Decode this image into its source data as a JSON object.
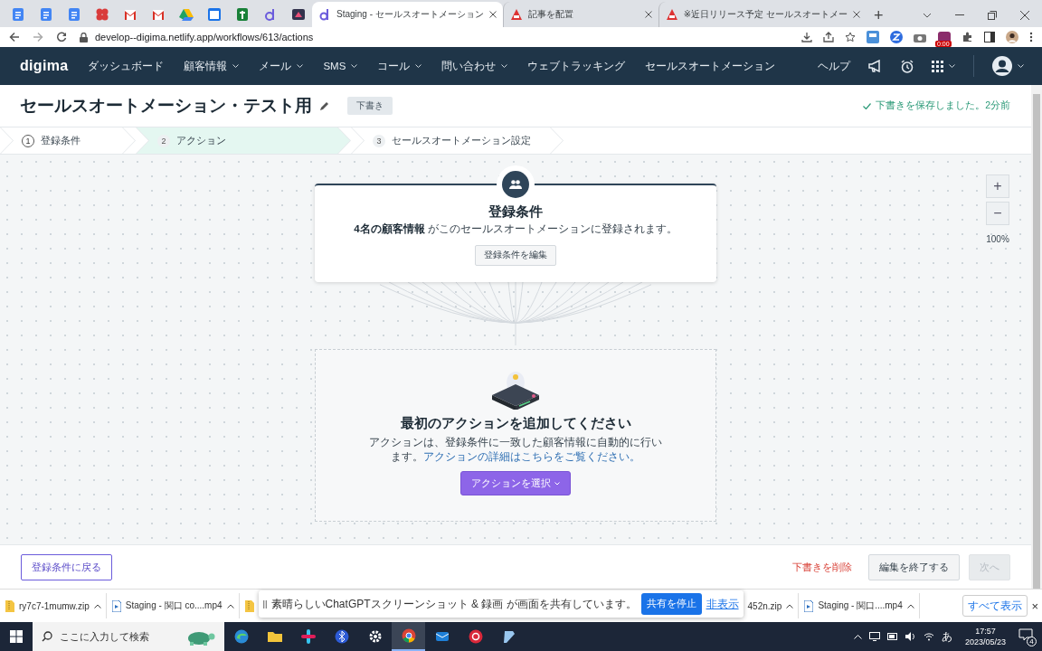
{
  "browser": {
    "tabs": [
      {
        "title": "Staging - セールスオートメーション",
        "selected": true,
        "kind": "digima"
      },
      {
        "title": "記事を配置",
        "selected": false,
        "kind": "cms"
      },
      {
        "title": "※近日リリース予定 セールスオートメー",
        "selected": false,
        "kind": "cms"
      }
    ],
    "new_tab": "+",
    "address": "develop--digima.netlify.app/workflows/613/actions",
    "recording_badge": "0:00"
  },
  "nav": {
    "logo": "digima",
    "items": [
      {
        "label": "ダッシュボード",
        "dropdown": false
      },
      {
        "label": "顧客情報",
        "dropdown": true
      },
      {
        "label": "メール",
        "dropdown": true
      },
      {
        "label": "SMS",
        "dropdown": true
      },
      {
        "label": "コール",
        "dropdown": true
      },
      {
        "label": "問い合わせ",
        "dropdown": true
      },
      {
        "label": "ウェブトラッキング",
        "dropdown": false
      },
      {
        "label": "セールスオートメーション",
        "dropdown": false
      }
    ],
    "help": "ヘルプ"
  },
  "header": {
    "title": "セールスオートメーション・テスト用",
    "status_badge": "下書き",
    "save_status": "下書きを保存しました。2分前"
  },
  "steps": [
    {
      "number": "1",
      "label": "登録条件",
      "selected": false,
      "completed": true
    },
    {
      "number": "2",
      "label": "アクション",
      "selected": true,
      "completed": false
    },
    {
      "number": "3",
      "label": "セールスオートメーション設定",
      "selected": false,
      "completed": false
    }
  ],
  "trigger_card": {
    "title": "登録条件",
    "summary": "**4名の顧客情報** がこのセールスオートメーションに登録されます。",
    "edit_button": "登録条件を編集"
  },
  "action_placeholder": {
    "heading": "最初のアクションを追加してください",
    "description": "アクションは、登録条件に一致した顧客情報に自動的に行います。",
    "link": "アクションの詳細はこちらをご覧ください。",
    "select_button": "アクションを選択"
  },
  "zoom": {
    "zoom_in": "+",
    "zoom_out": "−",
    "level_text": "100%"
  },
  "footer": {
    "back_button": "登録条件に戻る",
    "delete_button": "下書きを削除",
    "finish_button": "編集を終了する",
    "next_button": {
      "label": "次へ",
      "disabled": true
    }
  },
  "downloads": {
    "items": [
      {
        "name": "ry7c7-1mumw.zip",
        "kind": "zip"
      },
      {
        "name": "Staging - 関口 co....mp4",
        "kind": "video"
      },
      {
        "name": "452n.zip",
        "kind": "zip"
      },
      {
        "name": "Staging - 関口....mp4",
        "kind": "video"
      }
    ],
    "show_all": "すべて表示",
    "close": "×"
  },
  "share_banner": {
    "message": "素晴らしいChatGPTスクリーンショット & 録画 が画面を共有しています。",
    "stop_button": "共有を停止",
    "hide_link": "非表示"
  },
  "taskbar": {
    "search_placeholder": "ここに入力して検索",
    "ime": "あ",
    "time": "17:57",
    "date": "2023/05/23",
    "notification_count": "4"
  }
}
